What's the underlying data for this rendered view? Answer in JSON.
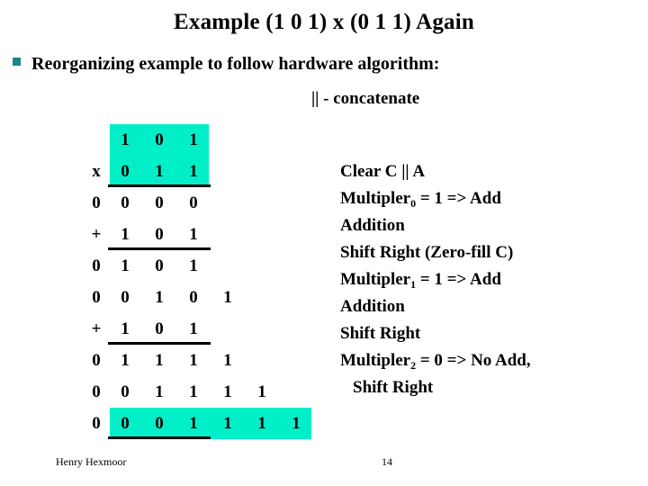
{
  "slide": {
    "title": "Example (1 0 1) x (0 1 1) Again",
    "bullet": {
      "marker": "square-bullet",
      "text": "Reorganizing example to follow hardware algorithm:"
    },
    "concatenate_note": "|| - concatenate"
  },
  "colors": {
    "highlight": "#00EFC9",
    "bullet": "#15868A",
    "text": "#000000",
    "background": "#FFFFFF"
  },
  "work_table": {
    "rows": [
      {
        "op": "",
        "digits": [
          "1",
          "0",
          "1",
          "",
          "",
          ""
        ]
      },
      {
        "op": "x",
        "digits": [
          "0",
          "1",
          "1",
          "",
          "",
          ""
        ]
      },
      {
        "op": "0",
        "digits": [
          "0",
          "0",
          "0",
          "",
          "",
          ""
        ]
      },
      {
        "op": "+",
        "digits": [
          "1",
          "0",
          "1",
          "",
          "",
          ""
        ]
      },
      {
        "op": "0",
        "digits": [
          "1",
          "0",
          "1",
          "",
          "",
          ""
        ]
      },
      {
        "op": "0",
        "digits": [
          "0",
          "1",
          "0",
          "1",
          "",
          ""
        ]
      },
      {
        "op": "+",
        "digits": [
          "1",
          "0",
          "1",
          "",
          "",
          ""
        ]
      },
      {
        "op": "0",
        "digits": [
          "1",
          "1",
          "1",
          "1",
          "",
          ""
        ]
      },
      {
        "op": "0",
        "digits": [
          "0",
          "1",
          "1",
          "1",
          "1",
          ""
        ]
      },
      {
        "op": "0",
        "digits": [
          "0",
          "0",
          "1",
          "1",
          "1",
          "1"
        ]
      }
    ]
  },
  "steps": [
    {
      "text": "Clear C || A",
      "sub": "",
      "tail": "",
      "indented": false
    },
    {
      "text": "Multipler",
      "sub": "0",
      "tail": " = 1 => Add",
      "indented": false
    },
    {
      "text": "Addition",
      "sub": "",
      "tail": "",
      "indented": false
    },
    {
      "text": "Shift Right (Zero-fill C)",
      "sub": "",
      "tail": "",
      "indented": false
    },
    {
      "text": "Multipler",
      "sub": "1",
      "tail": " = 1 => Add",
      "indented": false
    },
    {
      "text": "Addition",
      "sub": "",
      "tail": "",
      "indented": false
    },
    {
      "text": "Shift Right",
      "sub": "",
      "tail": "",
      "indented": false
    },
    {
      "text": "Multipler",
      "sub": "2",
      "tail": " = 0 => No Add,",
      "indented": false
    },
    {
      "text": "Shift Right",
      "sub": "",
      "tail": "",
      "indented": true
    }
  ],
  "footer": {
    "author": "Henry Hexmoor",
    "page_number": "14"
  }
}
